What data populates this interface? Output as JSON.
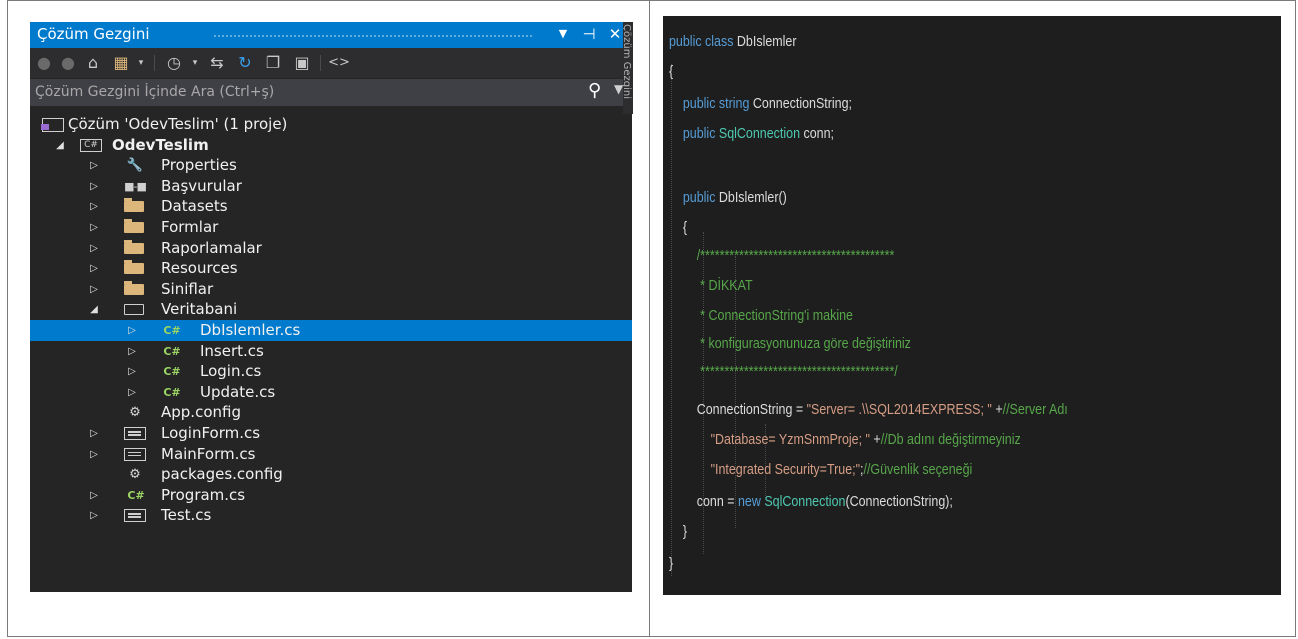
{
  "solution_explorer": {
    "title": "Çözüm Gezgini",
    "search_placeholder": "Çözüm Gezgini İçinde Ara (Ctrl+ş)",
    "side_tab": "Çözüm Gezgini",
    "toolbar_icons": [
      "back-icon",
      "forward-icon",
      "home-icon",
      "switch-views-icon",
      "dropdown-icon",
      "pending-changes-icon",
      "dropdown-icon",
      "sync-icon",
      "refresh-icon",
      "collapse-all-icon",
      "show-all-files-icon",
      "code-view-icon"
    ],
    "tree": [
      {
        "label": "Çözüm 'OdevTeslim' (1 proje)",
        "icon": "solution-icon",
        "arrow": "",
        "level": 0,
        "bold": false,
        "selected": false
      },
      {
        "label": "OdevTeslim",
        "icon": "csharp-project-icon",
        "arrow": "expanded",
        "level": 0,
        "bold": true,
        "selected": false
      },
      {
        "label": "Properties",
        "icon": "wrench-icon",
        "arrow": "collapsed",
        "level": 1,
        "bold": false,
        "selected": false
      },
      {
        "label": "Başvurular",
        "icon": "references-icon",
        "arrow": "collapsed",
        "level": 1,
        "bold": false,
        "selected": false
      },
      {
        "label": "Datasets",
        "icon": "folder-icon",
        "arrow": "collapsed",
        "level": 1,
        "bold": false,
        "selected": false
      },
      {
        "label": "Formlar",
        "icon": "folder-icon",
        "arrow": "collapsed",
        "level": 1,
        "bold": false,
        "selected": false
      },
      {
        "label": "Raporlamalar",
        "icon": "folder-icon",
        "arrow": "collapsed",
        "level": 1,
        "bold": false,
        "selected": false
      },
      {
        "label": "Resources",
        "icon": "folder-icon",
        "arrow": "collapsed",
        "level": 1,
        "bold": false,
        "selected": false
      },
      {
        "label": "Siniflar",
        "icon": "folder-icon",
        "arrow": "collapsed",
        "level": 1,
        "bold": false,
        "selected": false
      },
      {
        "label": "Veritabani",
        "icon": "folder-open-icon",
        "arrow": "expanded",
        "level": 1,
        "bold": false,
        "selected": false
      },
      {
        "label": "DbIslemler.cs",
        "icon": "csharp-file-icon",
        "arrow": "collapsed",
        "level": 2,
        "bold": false,
        "selected": true
      },
      {
        "label": "Insert.cs",
        "icon": "csharp-file-icon",
        "arrow": "collapsed",
        "level": 2,
        "bold": false,
        "selected": false
      },
      {
        "label": "Login.cs",
        "icon": "csharp-file-icon",
        "arrow": "collapsed",
        "level": 2,
        "bold": false,
        "selected": false
      },
      {
        "label": "Update.cs",
        "icon": "csharp-file-icon",
        "arrow": "collapsed",
        "level": 2,
        "bold": false,
        "selected": false
      },
      {
        "label": "App.config",
        "icon": "config-icon",
        "arrow": "",
        "level": 1,
        "bold": false,
        "selected": false
      },
      {
        "label": "LoginForm.cs",
        "icon": "form-icon",
        "arrow": "collapsed",
        "level": 1,
        "bold": false,
        "selected": false
      },
      {
        "label": "MainForm.cs",
        "icon": "form-icon",
        "arrow": "collapsed",
        "level": 1,
        "bold": false,
        "selected": false
      },
      {
        "label": "packages.config",
        "icon": "config-icon",
        "arrow": "",
        "level": 1,
        "bold": false,
        "selected": false
      },
      {
        "label": "Program.cs",
        "icon": "csharp-file-icon",
        "arrow": "collapsed",
        "level": 1,
        "bold": false,
        "selected": false
      },
      {
        "label": "Test.cs",
        "icon": "form-icon",
        "arrow": "collapsed",
        "level": 1,
        "bold": false,
        "selected": false
      }
    ]
  },
  "code_editor": {
    "lines": [
      [
        {
          "t": "public class ",
          "c": "kw"
        },
        {
          "t": "DbIslemler",
          "c": "pl"
        }
      ],
      [
        {
          "t": "{",
          "c": "pl"
        }
      ],
      [
        {
          "t": "    public ",
          "c": "kw"
        },
        {
          "t": "string ",
          "c": "kw"
        },
        {
          "t": "ConnectionString;",
          "c": "pl"
        }
      ],
      [
        {
          "t": "    public ",
          "c": "kw"
        },
        {
          "t": "SqlConnection ",
          "c": "ty"
        },
        {
          "t": "conn;",
          "c": "pl"
        }
      ],
      [],
      [
        {
          "t": "    public ",
          "c": "kw"
        },
        {
          "t": "DbIslemler()",
          "c": "pl"
        }
      ],
      [
        {
          "t": "    {",
          "c": "pl"
        }
      ],
      [
        {
          "t": "        /****************************************",
          "c": "cm"
        }
      ],
      [
        {
          "t": "         * DİKKAT",
          "c": "cm"
        }
      ],
      [
        {
          "t": "         * ConnectionString'i makine",
          "c": "cm"
        }
      ],
      [
        {
          "t": "         * konfigurasyonunuza göre değiştiriniz",
          "c": "cm"
        }
      ],
      [
        {
          "t": "         ****************************************/",
          "c": "cm"
        }
      ],
      [
        {
          "t": "        ConnectionString = ",
          "c": "pl"
        },
        {
          "t": "\"Server= .\\\\SQL2014EXPRESS; \"",
          "c": "str"
        },
        {
          "t": " +",
          "c": "pl"
        },
        {
          "t": "//Server Adı",
          "c": "cm"
        }
      ],
      [
        {
          "t": "            ",
          "c": "pl"
        },
        {
          "t": "\"Database= YzmSnmProje; \"",
          "c": "str"
        },
        {
          "t": " +",
          "c": "pl"
        },
        {
          "t": "//Db adını değiştirmeyiniz",
          "c": "cm"
        }
      ],
      [
        {
          "t": "            ",
          "c": "pl"
        },
        {
          "t": "\"Integrated Security=True;\"",
          "c": "str"
        },
        {
          "t": ";",
          "c": "pl"
        },
        {
          "t": "//Güvenlik seçeneği",
          "c": "cm"
        }
      ],
      [
        {
          "t": "        conn = ",
          "c": "pl"
        },
        {
          "t": "new ",
          "c": "kw"
        },
        {
          "t": "SqlConnection",
          "c": "ty"
        },
        {
          "t": "(ConnectionString);",
          "c": "pl"
        }
      ],
      [
        {
          "t": "    }",
          "c": "pl"
        }
      ],
      [
        {
          "t": "}",
          "c": "pl"
        }
      ]
    ]
  }
}
